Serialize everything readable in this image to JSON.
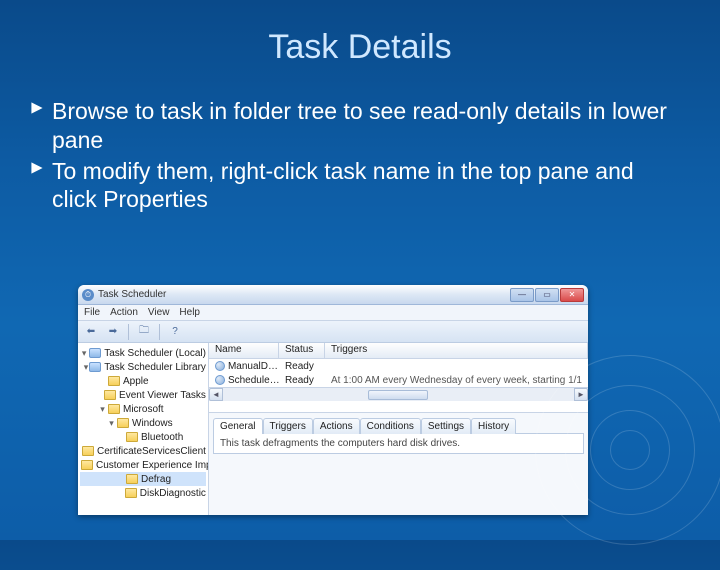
{
  "slide": {
    "title": "Task Details",
    "bullets": [
      "Browse to task in folder tree to see read-only details in lower pane",
      "To modify them, right-click task name in the top pane and click Properties"
    ]
  },
  "window": {
    "title": "Task Scheduler",
    "menu": {
      "file": "File",
      "action": "Action",
      "view": "View",
      "help": "Help"
    },
    "tree": {
      "root": "Task Scheduler (Local)",
      "library": "Task Scheduler Library",
      "nodes": [
        "Apple",
        "Event Viewer Tasks",
        "Microsoft"
      ],
      "windows": "Windows",
      "subnodes": [
        "Bluetooth",
        "CertificateServicesClient",
        "Customer Experience Impr",
        "Defrag",
        "DiskDiagnostic"
      ]
    }
  },
  "tasklist": {
    "columns": {
      "name": "Name",
      "status": "Status",
      "triggers": "Triggers"
    },
    "rows": [
      {
        "name": "ManualD…",
        "status": "Ready",
        "triggers": ""
      },
      {
        "name": "Schedule…",
        "status": "Ready",
        "triggers": "At 1:00 AM every Wednesday of every week, starting 1/1"
      }
    ]
  },
  "details": {
    "tabs": {
      "general": "General",
      "triggers": "Triggers",
      "actions": "Actions",
      "conditions": "Conditions",
      "settings": "Settings",
      "history": "History"
    },
    "description": "This task defragments the computers hard disk drives."
  }
}
